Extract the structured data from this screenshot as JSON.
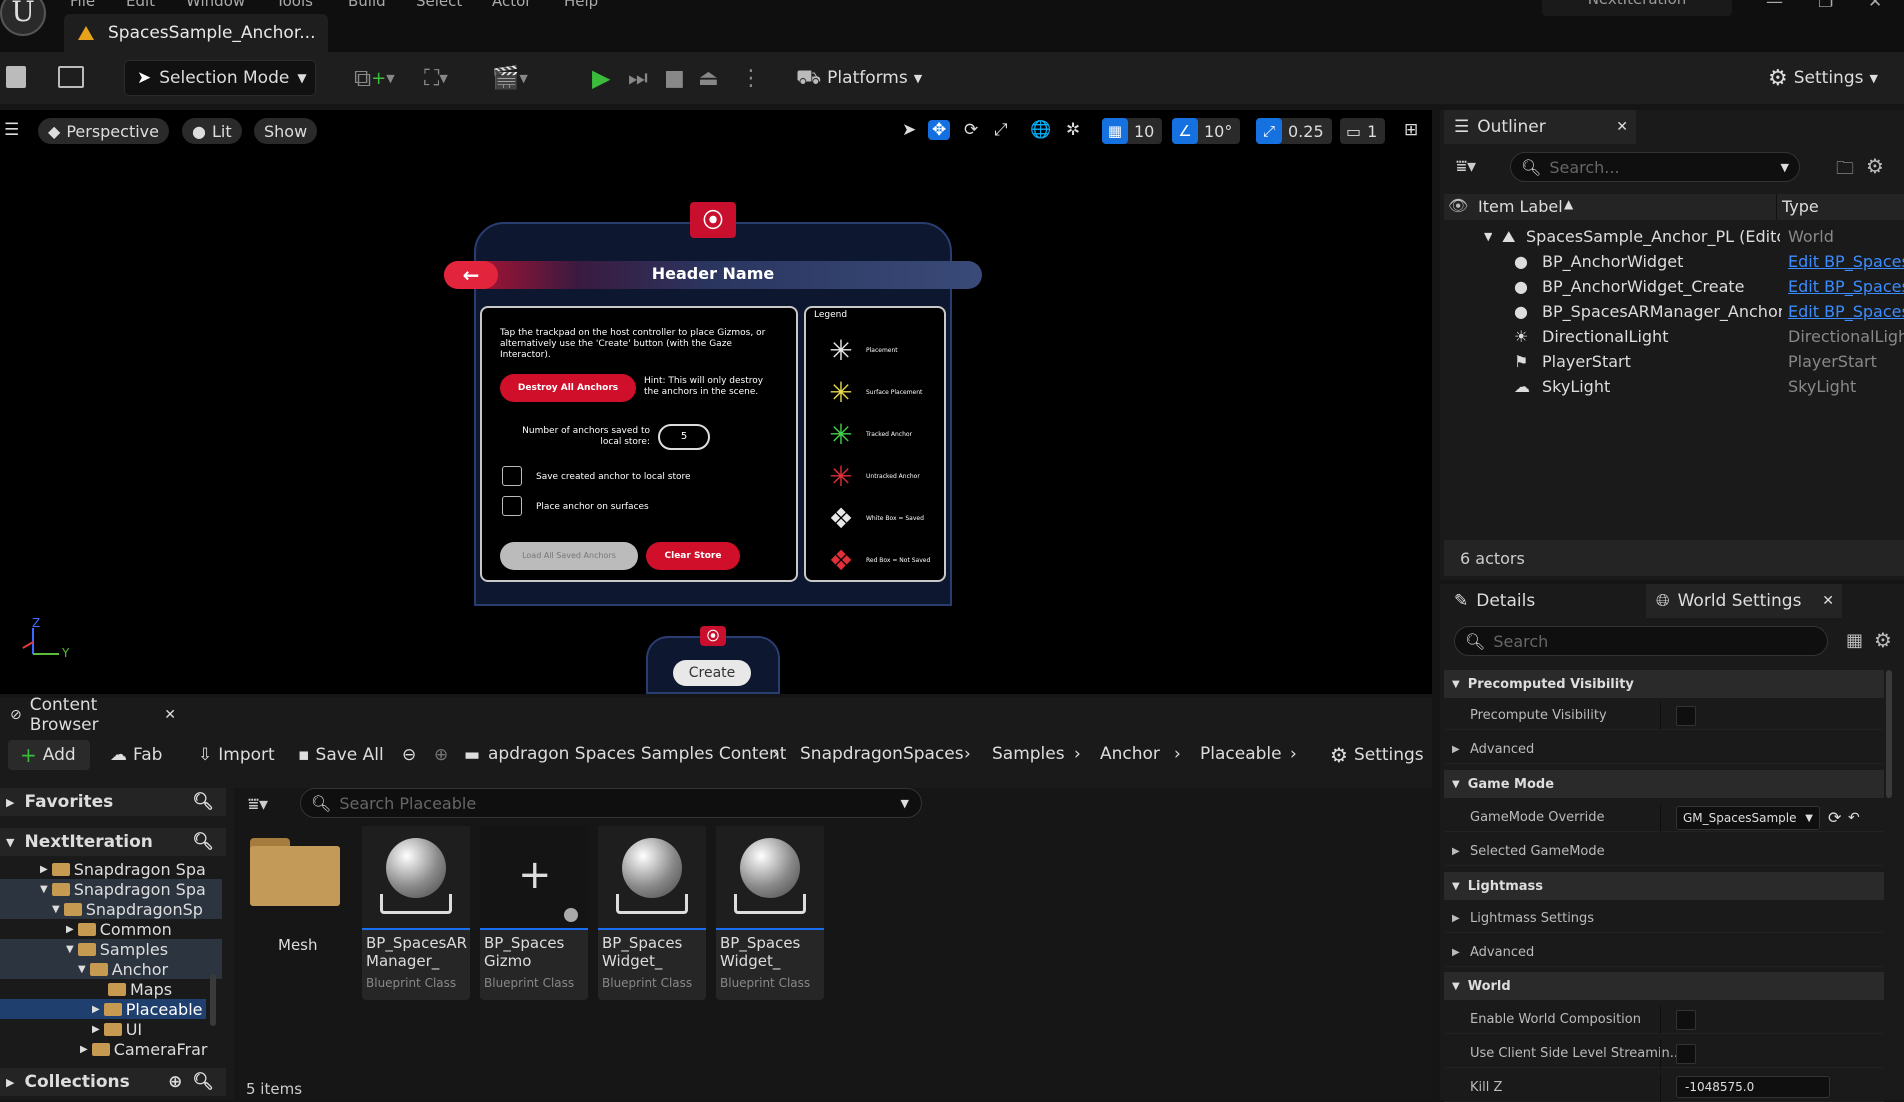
{
  "title_bar": {
    "menus": [
      "File",
      "Edit",
      "Window",
      "Tools",
      "Build",
      "Select",
      "Actor",
      "Help"
    ],
    "level_tab": "SpacesSample_Anchor...",
    "project": "NextIteration"
  },
  "toolbar": {
    "selection_mode": "Selection Mode",
    "platforms": "Platforms",
    "settings": "Settings"
  },
  "viewport": {
    "perspective": "Perspective",
    "lit": "Lit",
    "show": "Show",
    "grid_snap": "10",
    "rot_snap": "10°",
    "scale_snap": "0.25",
    "cam_speed": "1",
    "axis_z": "Z",
    "axis_y": "Y"
  },
  "widget": {
    "header": "Header Name",
    "back_arrow": "←",
    "instructions": "Tap the trackpad on the host controller to place Gizmos, or alternatively use the 'Create' button (with the Gaze Interactor).",
    "destroy_button": "Destroy All Anchors",
    "hint": "Hint: This will only destroy the anchors in the scene.",
    "anchors_label": "Number of anchors saved to local store:",
    "anchors_count": "5",
    "check_save": "Save created anchor to local store",
    "check_surfaces": "Place anchor on surfaces",
    "load_button": "Load All Saved Anchors",
    "clear_button": "Clear Store",
    "legend_title": "Legend",
    "legend": [
      {
        "label": "Placement",
        "color": "#e8e8e8"
      },
      {
        "label": "Surface Placement",
        "color": "#e8d84a"
      },
      {
        "label": "Tracked Anchor",
        "color": "#44d04a"
      },
      {
        "label": "Untracked Anchor",
        "color": "#e0303a"
      },
      {
        "label": "White Box = Saved",
        "color": "#e8e8e8"
      },
      {
        "label": "Red Box = Not Saved",
        "color": "#e0303a"
      }
    ],
    "create_button": "Create"
  },
  "outliner": {
    "tab": "Outliner",
    "search_placeholder": "Search...",
    "col_label": "Item Label",
    "col_type": "Type",
    "rows": [
      {
        "label": "SpacesSample_Anchor_PL (Editor)",
        "type": "World",
        "link": false
      },
      {
        "label": "BP_AnchorWidget",
        "type": "Edit BP_Spaces",
        "link": true
      },
      {
        "label": "BP_AnchorWidget_Create",
        "type": "Edit BP_Spaces",
        "link": true
      },
      {
        "label": "BP_SpacesARManager_Anchor",
        "type": "Edit BP_Spaces",
        "link": true
      },
      {
        "label": "DirectionalLight",
        "type": "DirectionalLight",
        "link": false
      },
      {
        "label": "PlayerStart",
        "type": "PlayerStart",
        "link": false
      },
      {
        "label": "SkyLight",
        "type": "SkyLight",
        "link": false
      }
    ],
    "actor_count": "6 actors"
  },
  "details": {
    "tab_details": "Details",
    "tab_world": "World Settings",
    "search_placeholder": "Search",
    "precomputed_visibility": "Precomputed Visibility",
    "precompute_visibility": "Precompute Visibility",
    "advanced": "Advanced",
    "game_mode": "Game Mode",
    "gamemode_override": "GameMode Override",
    "gamemode_value": "GM_SpacesSample",
    "selected_gamemode": "Selected GameMode",
    "lightmass": "Lightmass",
    "lightmass_settings": "Lightmass Settings",
    "advanced2": "Advanced",
    "world": "World",
    "enable_world_composition": "Enable World Composition",
    "client_side_streaming": "Use Client Side Level Streamin...",
    "kill_z": "Kill Z",
    "kill_z_value": "-1048575.0"
  },
  "content_browser": {
    "tab": "Content Browser",
    "add": "Add",
    "fab": "Fab",
    "import": "Import",
    "save_all": "Save All",
    "settings": "Settings",
    "breadcrumbs": [
      "apdragon Spaces Samples Content",
      "SnapdragonSpaces",
      "Samples",
      "Anchor",
      "Placeable"
    ],
    "favorites": "Favorites",
    "project": "NextIteration",
    "collections": "Collections",
    "search_placeholder": "Search Placeable",
    "tree": [
      "Snapdragon Spa",
      "Snapdragon Spa",
      "SnapdragonSp",
      "Common",
      "Samples",
      "Anchor",
      "Maps",
      "Placeable",
      "UI",
      "CameraFrar"
    ],
    "assets": [
      {
        "name": "Mesh",
        "class": ""
      },
      {
        "name": "BP_SpacesAR\nManager_",
        "class": "Blueprint Class"
      },
      {
        "name": "BP_Spaces\nGizmo",
        "class": "Blueprint Class"
      },
      {
        "name": "BP_Spaces\nWidget_",
        "class": "Blueprint Class"
      },
      {
        "name": "BP_Spaces\nWidget_",
        "class": "Blueprint Class"
      }
    ],
    "item_count": "5 items"
  }
}
